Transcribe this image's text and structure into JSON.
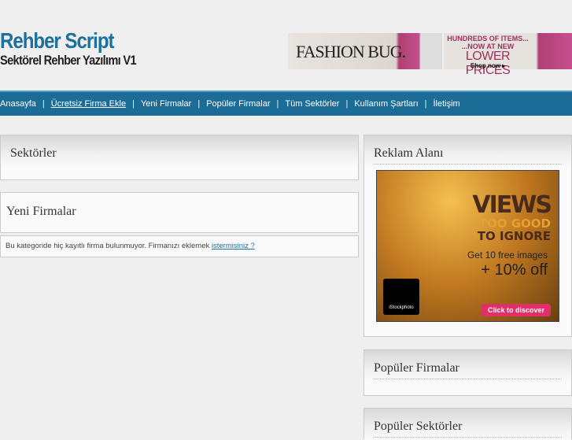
{
  "site": {
    "title": "Rehber Script",
    "subtitle": "Sektörel Rehber Yazılımı V1"
  },
  "banner": {
    "brand": "FASHION BUG.",
    "line1": "HUNDREDS OF ITEMS...",
    "line2": "...NOW AT NEW",
    "headline": "LOWER PRICES",
    "cta": "Shop now ▸"
  },
  "nav": {
    "items": [
      {
        "label": "Anasayfa"
      },
      {
        "label": "Ücretsiz Firma Ekle"
      },
      {
        "label": "Yeni Firmalar"
      },
      {
        "label": "Popüler Firmalar"
      },
      {
        "label": "Tüm Sektörler"
      },
      {
        "label": "Kullanım Şartları"
      },
      {
        "label": "İletişim"
      }
    ],
    "separator": "|"
  },
  "main": {
    "sectors_title": "Sektörler",
    "new_title": "Yeni Firmalar",
    "empty_text": "Bu kategoride hiç kayıtlı firma bulunmuyor. Firmanızı eklemek ",
    "empty_link": "istermisiniz ?"
  },
  "sidebar": {
    "ad_title": "Reklam Alanı",
    "popular_firms_title": "Popüler Firmalar",
    "popular_sectors_title": "Popüler Sektörler",
    "ad": {
      "views": "VIEWS",
      "too_good": "TOO GOOD",
      "to_ignore": "TO IGNORE",
      "offer1": "Get 10 free images",
      "offer2": "+ 10% off",
      "brand": "iStockphoto",
      "cta": "Click to discover"
    }
  },
  "colors": {
    "brand": "#1d6f9c",
    "nav": "#1b6d98"
  }
}
